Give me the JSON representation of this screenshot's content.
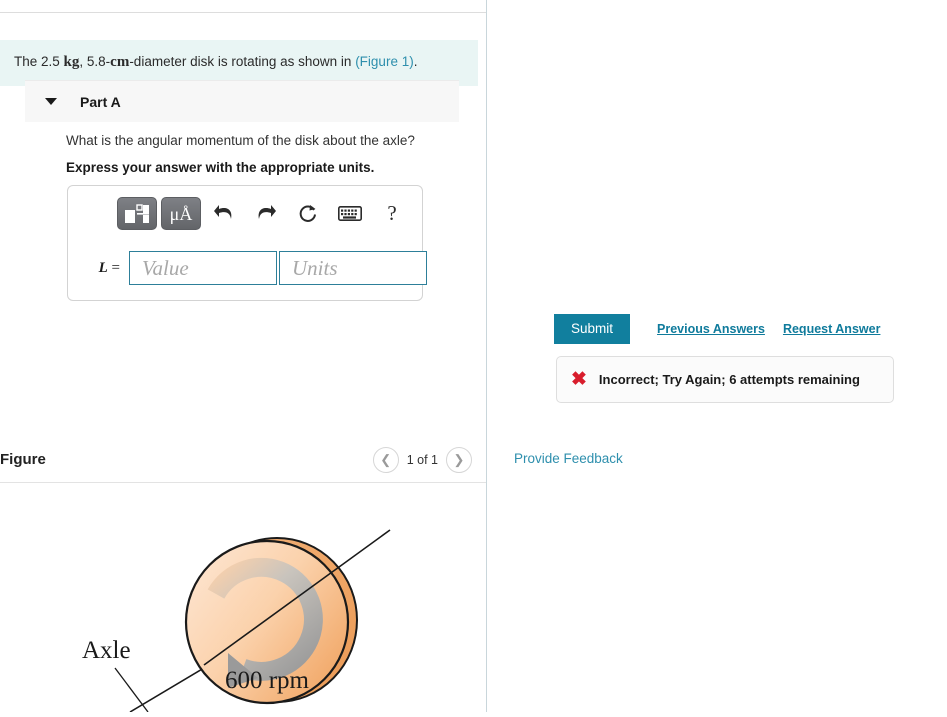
{
  "problem": {
    "text_before": "The 2.5",
    "unit_mass": "kg",
    "text_middle": ", 5.8-",
    "unit_length": "cm",
    "text_after": "-diameter disk is rotating as shown in",
    "figure_link": "(Figure 1)",
    "text_end": "."
  },
  "figure_panel": {
    "title": "Figure",
    "prev_icon": "chevron-left-icon",
    "next_icon": "chevron-right-icon",
    "page_label": "1 of 1",
    "diagram": {
      "axle_label": "Axle",
      "rpm_label": "600 rpm",
      "disk_fill_light": "#fbd9ba",
      "disk_fill_dark": "#f0a868",
      "disk_edge": "#1a1a1a",
      "arrow_color": "#9a9a9a"
    }
  },
  "part": {
    "caret_icon": "caret-down-icon",
    "title": "Part A",
    "question": "What is the angular momentum of the disk about the axle?",
    "instruction": "Express your answer with the appropriate units.",
    "toolbar": {
      "template_icon": "math-template-icon",
      "units_icon": "micro-angstrom-icon",
      "units_label": "μÅ",
      "undo_icon": "undo-arrow-icon",
      "redo_icon": "redo-arrow-icon",
      "reset_icon": "reset-circle-icon",
      "keyboard_icon": "keyboard-icon",
      "help_icon": "help-question-icon",
      "help_label": "?"
    },
    "answer": {
      "variable_label": "L",
      "equals": "=",
      "value_placeholder": "Value",
      "units_placeholder": "Units",
      "value": "",
      "units": ""
    },
    "submit_label": "Submit",
    "previous_answers_label": "Previous Answers",
    "request_answer_label": "Request Answer",
    "feedback": {
      "status_icon": "x-mark-icon",
      "status_glyph": "✖",
      "message": "Incorrect; Try Again; 6 attempts remaining",
      "color": "#d81d2c"
    }
  },
  "footer": {
    "provide_feedback_label": "Provide Feedback"
  },
  "colors": {
    "accent_teal": "#117f9e",
    "link_blue": "#2e8fad",
    "statement_bg": "#e9f5f4"
  }
}
